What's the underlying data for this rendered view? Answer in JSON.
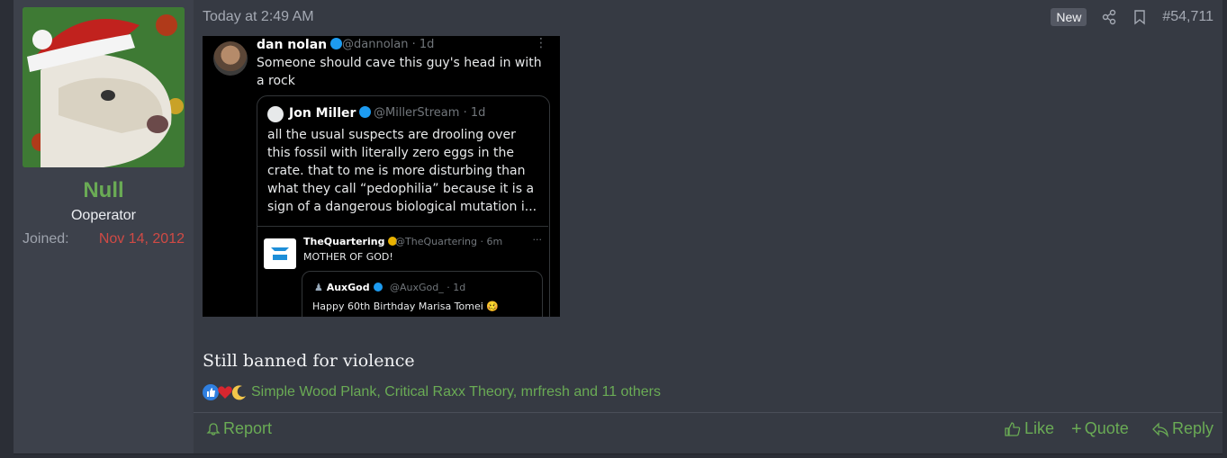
{
  "user": {
    "name": "Null",
    "title": "Ooperator",
    "joined_label": "Joined:",
    "joined_date": "Nov 14, 2012",
    "avatar_icon": "dog-with-santa-hat-avatar"
  },
  "post": {
    "timestamp": "Today at 2:49 AM",
    "new_badge": "New",
    "share_icon": "share-icon",
    "bookmark_icon": "bookmark-icon",
    "number": "#54,711",
    "text": "Still banned for violence"
  },
  "embed": {
    "tweet1": {
      "name": "dan nolan",
      "handle": "@dannolan · 1d",
      "text_line1": "Someone should cave this guy's head in with",
      "text_line2": "a rock"
    },
    "tweet2": {
      "name": "Jon Miller",
      "handle": "@MillerStream · 1d",
      "lines": [
        "all the usual suspects are drooling over",
        "this fossil with literally zero eggs in the",
        "crate. that to me is more disturbing than",
        "what they call “pedophilia” because it is a",
        "sign of a dangerous biological mutation i..."
      ]
    },
    "tweet3": {
      "name": "TheQuartering",
      "handle": "@TheQuartering · 6m",
      "text": "MOTHER OF GOD!"
    },
    "tweet4": {
      "name": "AuxGod",
      "handle": "@AuxGod_ · 1d",
      "text": "Happy 60th Birthday Marisa Tomei 🥴"
    }
  },
  "reactions": {
    "icons": [
      "like-reaction-icon",
      "love-reaction-icon",
      "moon-reaction-icon"
    ],
    "text": "Simple Wood Plank, Critical Raxx Theory, mrfresh and 11 others"
  },
  "footer": {
    "report": "Report",
    "like": "Like",
    "quote": "Quote",
    "reply": "Reply"
  },
  "colors": {
    "accent_green": "#6aab55",
    "joined_red": "#d04a45",
    "post_bg": "#363a43",
    "user_col_bg": "#3d414b"
  }
}
